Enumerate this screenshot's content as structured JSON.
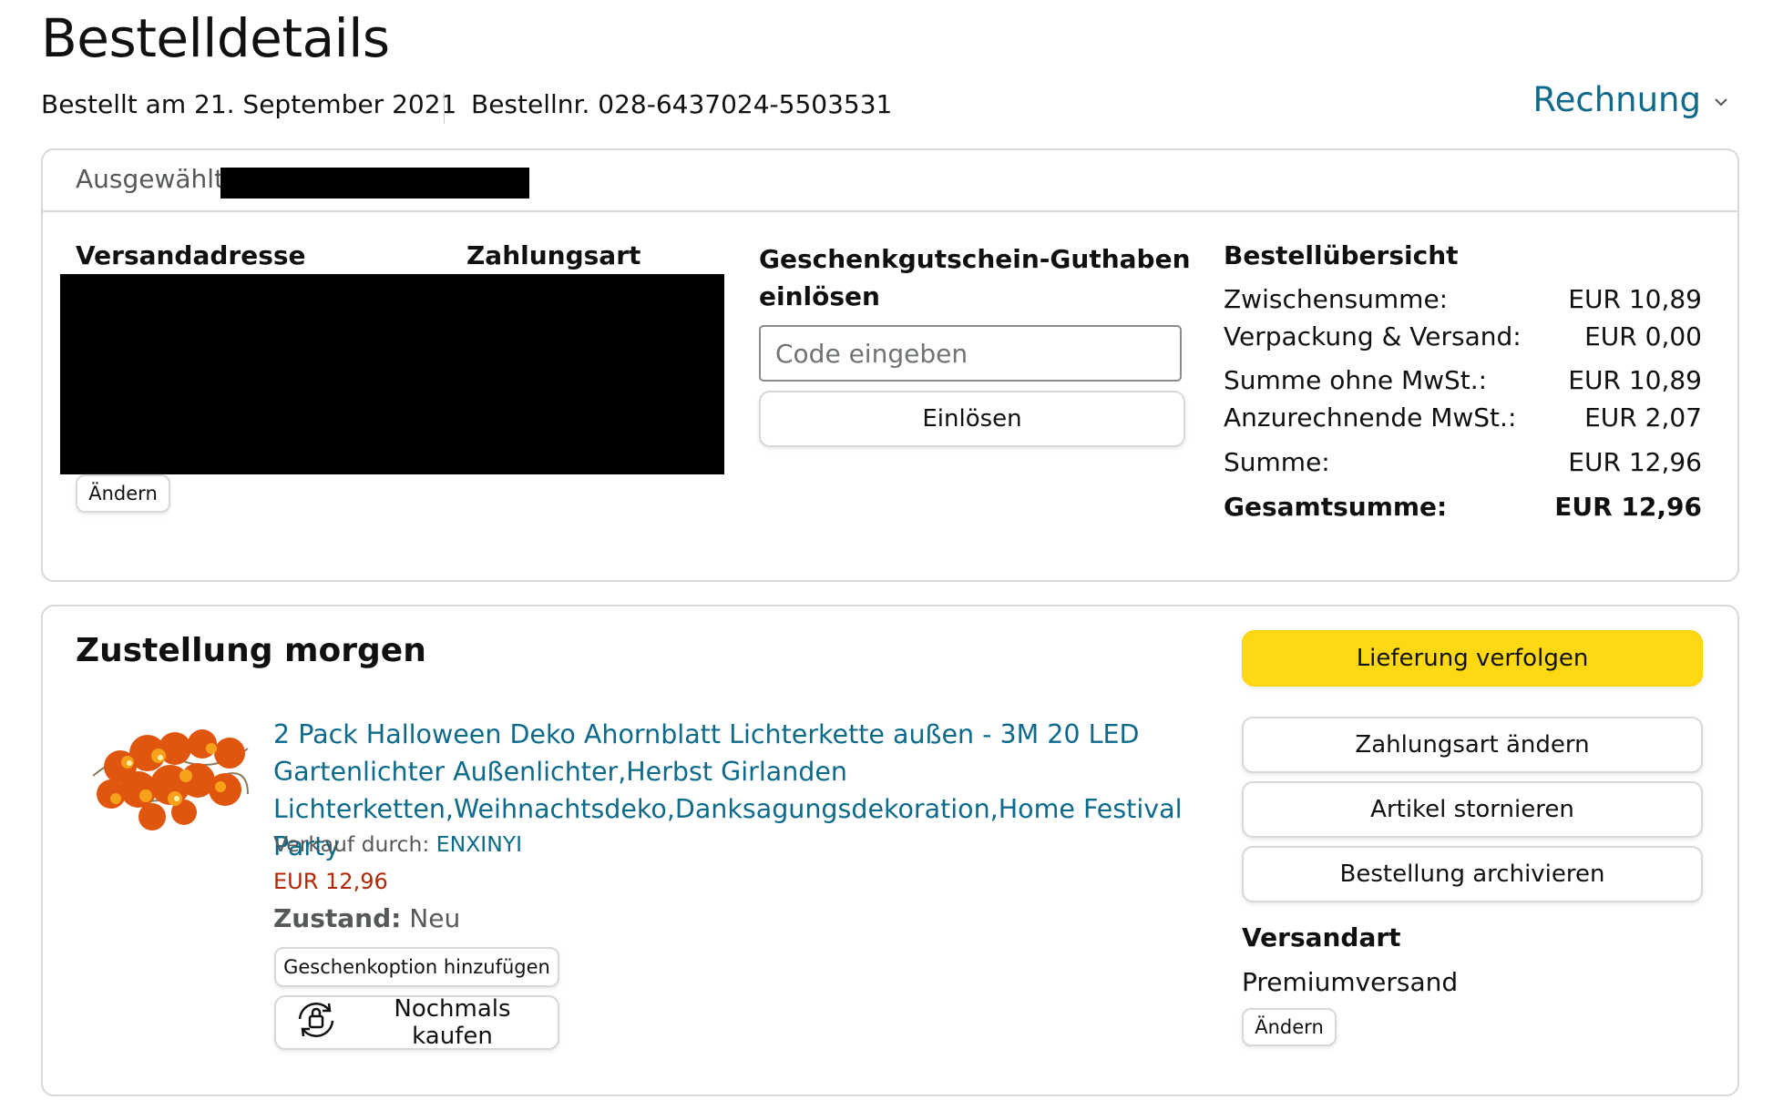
{
  "page": {
    "title": "Bestelldetails"
  },
  "order": {
    "date_text": "Bestellt am 21. September 2021",
    "number_text": "Bestellnr. 028-6437024-5503531",
    "invoice_label": "Rechnung",
    "selected_label": "Ausgewählt:"
  },
  "shipping": {
    "address_heading": "Versandadresse",
    "payment_heading": "Zahlungsart",
    "change_button": "Ändern"
  },
  "gift_card": {
    "heading_line1": "Geschenkgutschein-Guthaben",
    "heading_line2": "einlösen",
    "input_placeholder": "Code eingeben",
    "redeem_button": "Einlösen"
  },
  "summary": {
    "heading": "Bestellübersicht",
    "rows": [
      {
        "label": "Zwischensumme:",
        "value": "EUR 10,89"
      },
      {
        "label": "Verpackung & Versand:",
        "value": "EUR 0,00"
      },
      {
        "label": "Summe ohne MwSt.:",
        "value": "EUR 10,89"
      },
      {
        "label": "Anzurechnende MwSt.:",
        "value": "EUR 2,07"
      },
      {
        "label": "Summe:",
        "value": "EUR 12,96"
      }
    ],
    "total_label": "Gesamtsumme:",
    "total_value": "EUR 12,96"
  },
  "delivery": {
    "title": "Zustellung morgen",
    "product": {
      "title_line1": "2 Pack Halloween Deko Ahornblatt Lichterkette außen - 3M 20 LED",
      "title_line2": "Gartenlichter Außenlichter,Herbst Girlanden",
      "title_line3": "Lichterketten,Weihnachtsdeko,Danksagungsdekoration,Home Festival Party",
      "seller_label": "Verkauf durch: ",
      "seller_name": "ENXINYI",
      "price": "EUR 12,96",
      "condition_label": "Zustand:",
      "condition_value": "Neu",
      "gift_button": "Geschenkoption hinzufügen",
      "buy_again_button": "Nochmals kaufen"
    },
    "actions": {
      "track": "Lieferung verfolgen",
      "change_payment": "Zahlungsart ändern",
      "cancel_items": "Artikel stornieren",
      "archive": "Bestellung archivieren"
    },
    "shipping_method": {
      "heading": "Versandart",
      "value": "Premiumversand",
      "change_button": "Ändern"
    }
  },
  "colors": {
    "link": "#0e6a8a",
    "price": "#b12704",
    "primary_button": "#ffd814",
    "border": "#d5d9d9"
  },
  "icons": [
    "chevron-down-icon",
    "buy-again-icon"
  ]
}
